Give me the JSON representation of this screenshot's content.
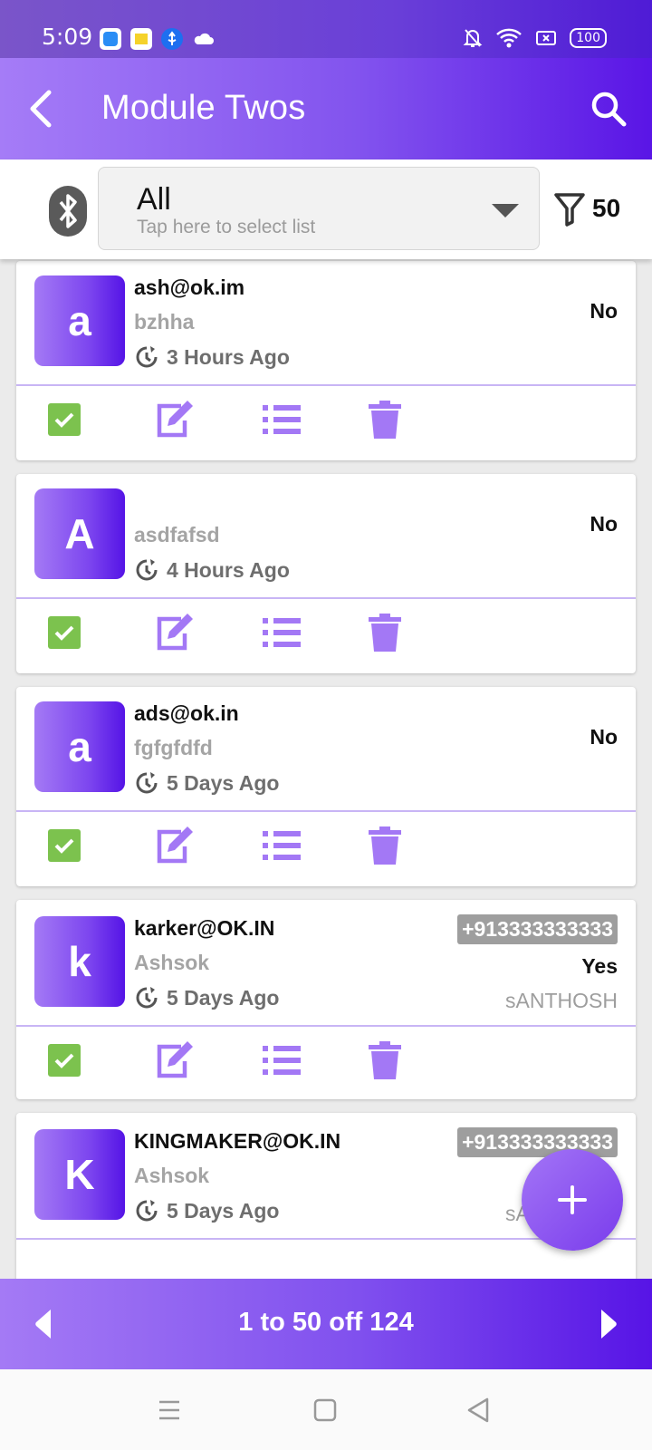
{
  "status_bar": {
    "time": "5:09",
    "battery": "100"
  },
  "app_bar": {
    "title": "Module Twos"
  },
  "filter": {
    "selected_list": "All",
    "hint": "Tap here to select list",
    "count": "50"
  },
  "cards": [
    {
      "initial": "a",
      "email": "ash@ok.im",
      "name": "bzhha",
      "time": "3 Hours Ago",
      "phone": "",
      "status": "No",
      "owner": "",
      "done": true
    },
    {
      "initial": "A",
      "email": "",
      "name": "asdfafsd",
      "time": "4 Hours Ago",
      "phone": "",
      "status": "No",
      "owner": "",
      "done": true
    },
    {
      "initial": "a",
      "email": "ads@ok.in",
      "name": "fgfgfdfd",
      "time": "5 Days Ago",
      "phone": "",
      "status": "No",
      "owner": "",
      "done": true
    },
    {
      "initial": "k",
      "email": "karker@OK.IN",
      "name": "Ashsok",
      "time": "5 Days Ago",
      "phone": "+913333333333",
      "status": "Yes",
      "owner": "sANTHOSH",
      "done": true
    },
    {
      "initial": "K",
      "email": "KINGMAKER@OK.IN",
      "name": "Ashsok",
      "time": "5 Days Ago",
      "phone": "+913333333333",
      "status": "",
      "owner": "sANTHOSH",
      "done": true
    }
  ],
  "pager": {
    "text": "1 to 50 off 124"
  },
  "colors": {
    "accent": "#7d46ef",
    "accent_light": "#a47af5",
    "accent_dark": "#5514e6",
    "check_green": "#7cc24e",
    "action_icon": "#a378f5"
  },
  "icons": {
    "back": "back-arrow-icon",
    "search": "search-icon",
    "bluetooth": "bluetooth-icon",
    "filter": "filter-icon",
    "clock": "clock-icon",
    "check": "check-icon",
    "edit": "edit-icon",
    "list": "list-icon",
    "delete": "trash-icon",
    "add": "plus-icon"
  }
}
